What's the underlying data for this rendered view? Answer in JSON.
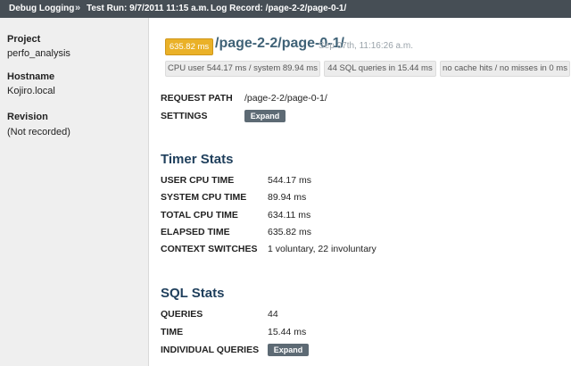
{
  "breadcrumbs": {
    "app": "Debug Logging",
    "sep1": "»",
    "test_run": "Test Run: 9/7/2011 11:15 a.m.",
    "sep2": "»",
    "log_record": "Log Record: /page-2-2/page-0-1/"
  },
  "sidebar": {
    "project_label": "Project",
    "project_value": "perfo_analysis",
    "hostname_label": "Hostname",
    "hostname_value": "Kojiro.local",
    "revision_label": "Revision",
    "revision_value": "(Not recorded)"
  },
  "record": {
    "elapsed_badge": "635.82 ms",
    "path": "/page-2-2/page-0-1/",
    "date": "Sep 07th, 11:16:26 a.m.",
    "summary_pills": [
      "CPU user 544.17 ms / system 89.94 ms",
      "44 SQL queries in 15.44 ms",
      "no cache hits / no misses in 0 ms"
    ]
  },
  "request": {
    "path_label": "REQUEST PATH",
    "path_value": "/page-2-2/page-0-1/",
    "settings_label": "SETTINGS",
    "settings_button": "Expand"
  },
  "timer_stats": {
    "title": "Timer Stats",
    "rows": [
      {
        "label": "USER CPU TIME",
        "value": "544.17 ms"
      },
      {
        "label": "SYSTEM CPU TIME",
        "value": "89.94 ms"
      },
      {
        "label": "TOTAL CPU TIME",
        "value": "634.11 ms"
      },
      {
        "label": "ELAPSED TIME",
        "value": "635.82 ms"
      },
      {
        "label": "CONTEXT SWITCHES",
        "value": "1 voluntary, 22 involuntary"
      }
    ]
  },
  "sql_stats": {
    "title": "SQL Stats",
    "queries_label": "QUERIES",
    "queries_value": "44",
    "time_label": "TIME",
    "time_value": "15.44 ms",
    "individual_label": "INDIVIDUAL QUERIES",
    "individual_button": "Expand"
  },
  "colors": {
    "topbar": "#464e55",
    "sidebar": "#efefef",
    "badge": "#eab128",
    "title_link": "#3f6277",
    "section_heading": "#1f3f5c",
    "button": "#5d6a74"
  }
}
